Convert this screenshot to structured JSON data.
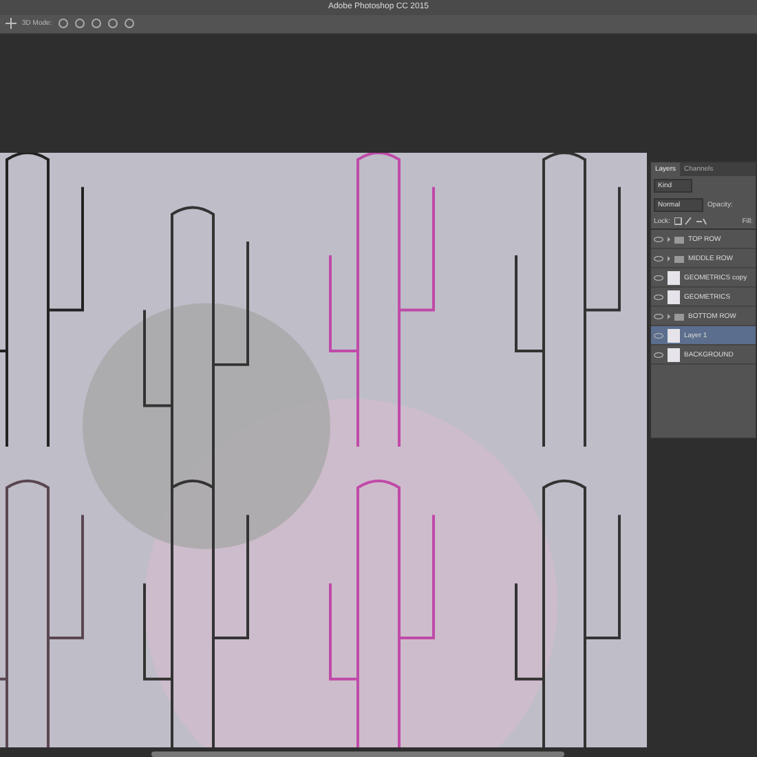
{
  "window": {
    "title": "Adobe Photoshop CC 2015"
  },
  "options_bar": {
    "mode_label": "3D Mode:"
  },
  "layers_panel": {
    "tabs": [
      {
        "label": "Layers",
        "selected": true
      },
      {
        "label": "Channels",
        "selected": false
      }
    ],
    "filter": "Kind",
    "blend_mode": "Normal",
    "opacity_label": "Opacity:",
    "lock_label": "Lock:",
    "fill_label": "Fill:",
    "layers": [
      {
        "name": "TOP ROW",
        "kind": "group",
        "visible": true,
        "selected": false
      },
      {
        "name": "MIDDLE ROW",
        "kind": "group",
        "visible": true,
        "selected": false
      },
      {
        "name": "GEOMETRICS copy",
        "kind": "layer",
        "visible": true,
        "selected": false
      },
      {
        "name": "GEOMETRICS",
        "kind": "layer",
        "visible": true,
        "selected": false
      },
      {
        "name": "BOTTOM ROW",
        "kind": "group",
        "visible": true,
        "selected": false
      },
      {
        "name": "Layer 1",
        "kind": "layer",
        "visible": true,
        "selected": true
      },
      {
        "name": "BACKGROUND",
        "kind": "layer",
        "visible": true,
        "selected": false
      }
    ]
  }
}
